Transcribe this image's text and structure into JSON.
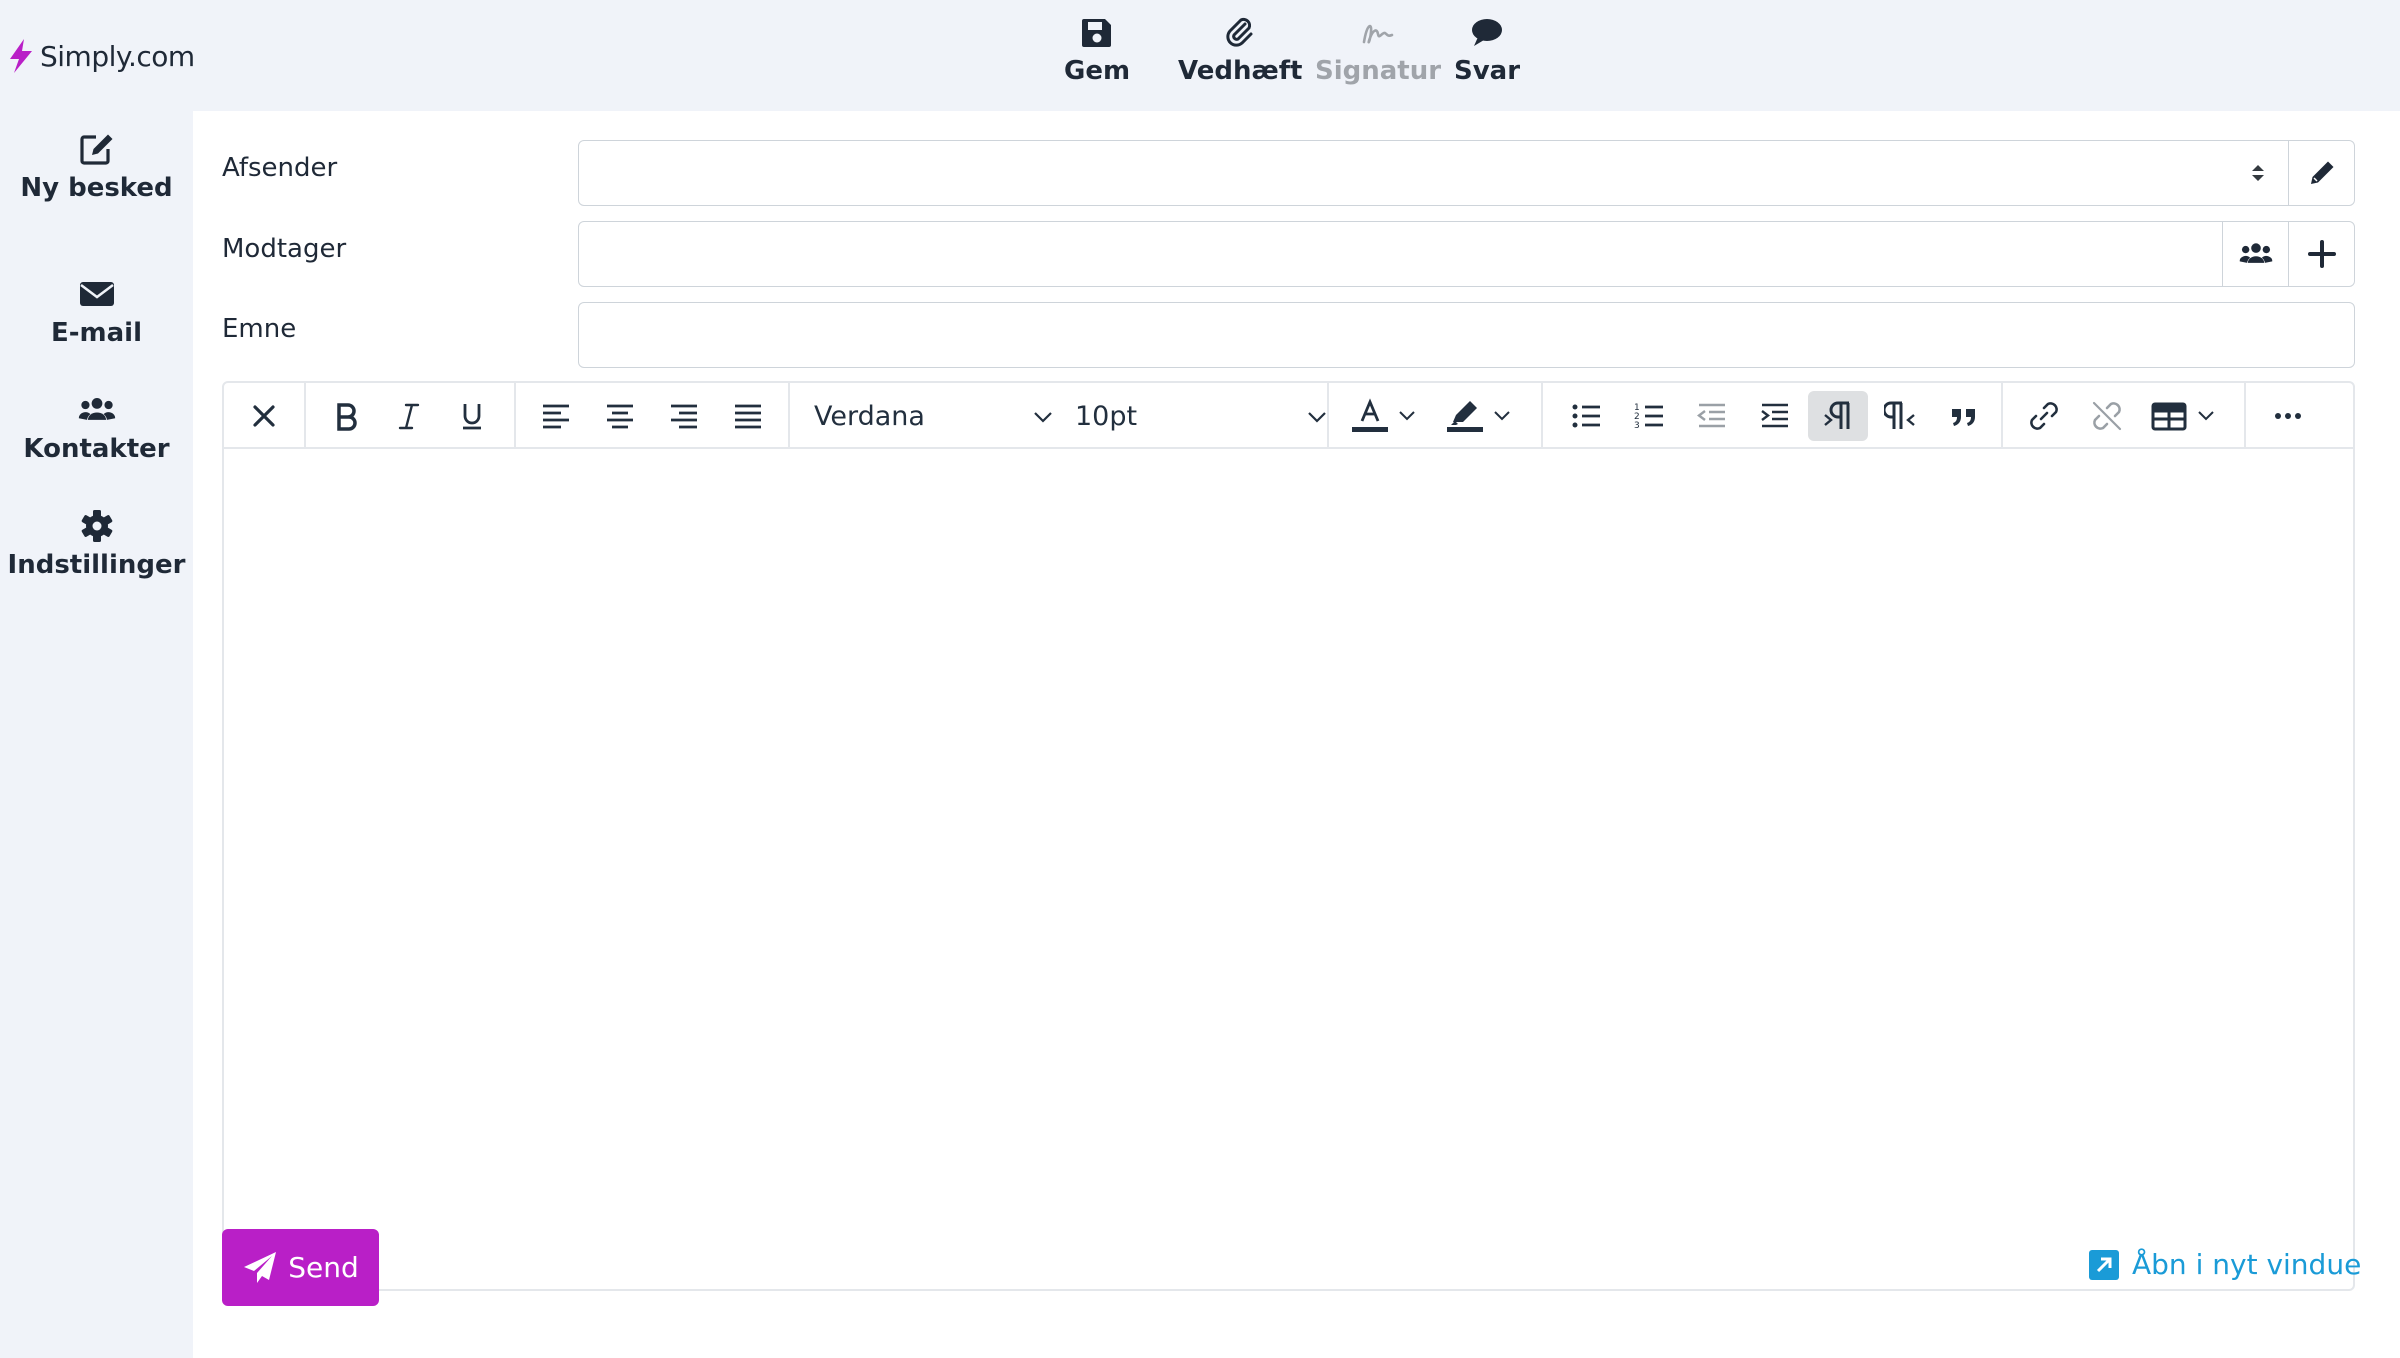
{
  "brand": {
    "name": "Simply.com",
    "accent_color": "#b91fc7",
    "link_color": "#1a9bd7"
  },
  "topbar": {
    "save": {
      "label": "Gem",
      "icon": "floppy-disk-icon"
    },
    "attach": {
      "label": "Vedhæft",
      "icon": "paperclip-icon"
    },
    "signature": {
      "label": "Signatur",
      "icon": "signature-icon",
      "disabled": true
    },
    "reply": {
      "label": "Svar",
      "icon": "speech-bubble-icon"
    }
  },
  "sidebar": {
    "items": [
      {
        "label": "Ny besked",
        "icon": "edit-icon"
      },
      {
        "label": "E-mail",
        "icon": "envelope-icon"
      },
      {
        "label": "Kontakter",
        "icon": "users-icon"
      },
      {
        "label": "Indstillinger",
        "icon": "gear-icon"
      }
    ]
  },
  "form": {
    "sender": {
      "label": "Afsender",
      "value": ""
    },
    "recipient": {
      "label": "Modtager",
      "value": ""
    },
    "subject": {
      "label": "Emne",
      "value": ""
    }
  },
  "editor": {
    "font_family": "Verdana",
    "font_size": "10pt",
    "content": ""
  },
  "footer": {
    "send_label": "Send",
    "open_window_label": "Åbn i nyt vindue"
  }
}
